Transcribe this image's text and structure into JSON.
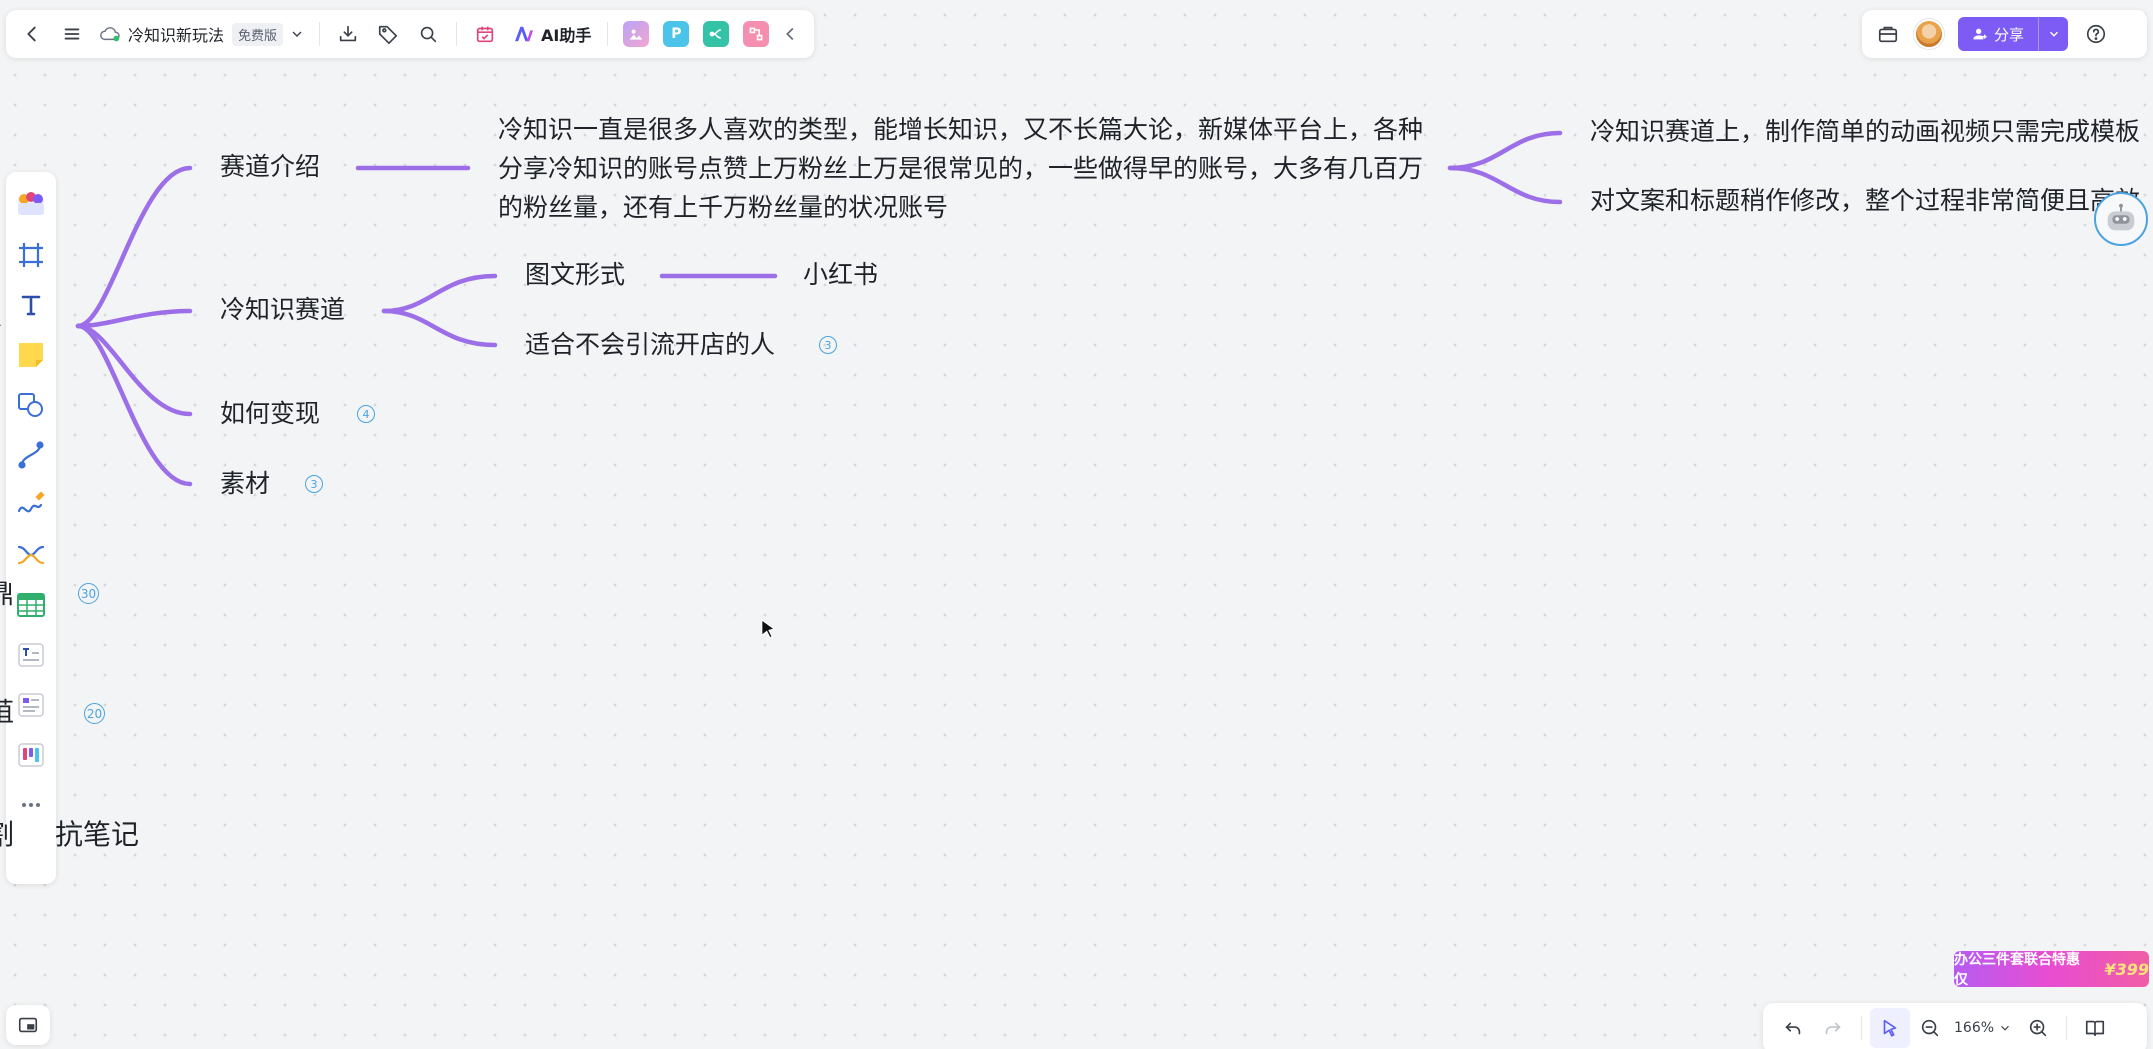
{
  "toolbar": {
    "doc_title": "冷知识新玩法",
    "plan_badge": "免费版",
    "ai_label": "AI助手",
    "app_p_letter": "P",
    "share_label": "分享"
  },
  "mindmap": {
    "branches": [
      {
        "label": "赛道介绍"
      },
      {
        "label": "冷知识赛道"
      },
      {
        "label": "如何变现",
        "count": "4"
      },
      {
        "label": "素材",
        "count": "3"
      }
    ],
    "intro_paragraph": "冷知识一直是很多人喜欢的类型，能增长知识，又不长篇大论，新媒体平台上，各种分享冷知识的账号点赞上万粉丝上万是很常见的，一些做得早的账号，大多有几百万的粉丝量，还有上千万粉丝量的状况账号",
    "intro_children": [
      "冷知识赛道上，制作简单的动画视频只需完成模板",
      "对文案和标题稍作修改，整个过程非常简便且高效"
    ],
    "track_children": [
      {
        "label": "图文形式"
      },
      {
        "label": "适合不会引流开店的人",
        "count": "3"
      }
    ],
    "format_child": "小红书",
    "left_counts": [
      "30",
      "20"
    ],
    "left_partial": {
      "mark_a": "、",
      "mark_b": "鼎",
      "mark_c": "菹",
      "bottom_text": "抗笔记",
      "bottom_prefix": "割"
    }
  },
  "bottom_bar": {
    "zoom_level": "166%"
  },
  "promo": {
    "text": "办公三件套联合特惠 仅",
    "price": "¥399"
  },
  "colors": {
    "branch": "#9c6ee8",
    "accent": "#7c5cf5",
    "count_badge": "#4aa3e0"
  }
}
